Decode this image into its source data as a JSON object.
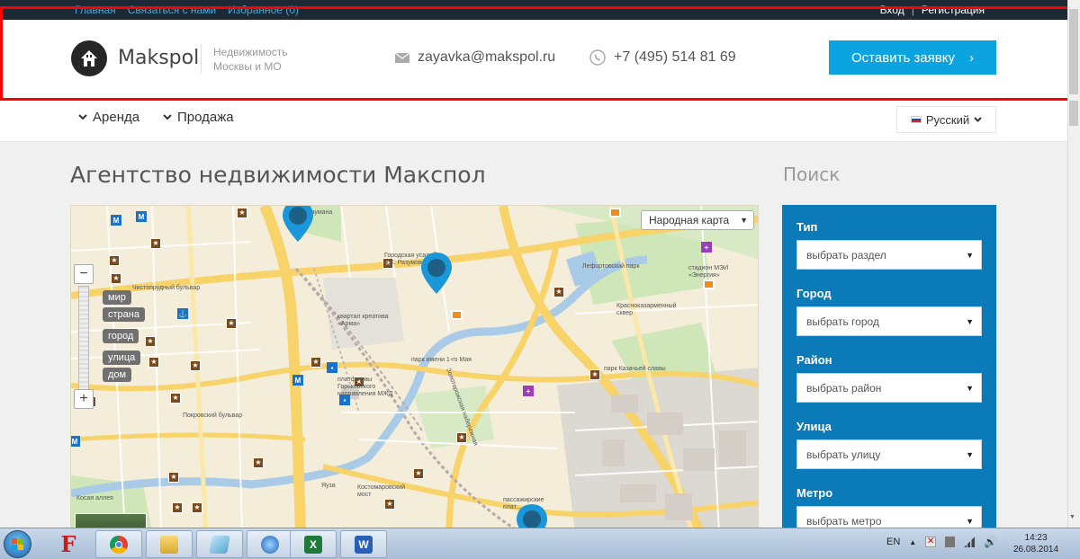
{
  "topbar": {
    "links_left": [
      "Главная",
      "Связаться с нами",
      "Избранное (0)"
    ],
    "login": "Вход",
    "separator": "|",
    "register": "Регистрация"
  },
  "header": {
    "logo_text": "Makspol",
    "tagline_line1": "Недвижимость",
    "tagline_line2": "Москвы и МО",
    "email": "zayavka@makspol.ru",
    "phone": "+7 (495) 514 81 69",
    "cta_label": "Оставить заявку",
    "cta_arrow": "›"
  },
  "nav": {
    "items": [
      "Аренда",
      "Продажа"
    ],
    "language": "Русский"
  },
  "main": {
    "title": "Агентство недвижимости Макспол",
    "search_title": "Поиск"
  },
  "map": {
    "type_selector": "Народная карта",
    "zoom_levels": [
      "мир",
      "страна",
      "город",
      "улица",
      "дом"
    ],
    "zoom_in": "+",
    "zoom_out": "−",
    "labels": [
      "Чистопрудный бульвар",
      "Городская усадьба А.К. Разумовского",
      "квартал креатива «Арма»",
      "парк имени 1-го Мая",
      "платформы Горьковского направления МЖД",
      "Покровский бульвар",
      "Лефортовский парк",
      "стадион МЭИ «Энергия»",
      "Красноказарменный сквер",
      "парк Казачьей славы",
      "Золоторожская набережная",
      "Яуза",
      "Костомаровский мост",
      "Косая аллея",
      "пассажирские плат...",
      "Баумана"
    ]
  },
  "search": {
    "fields": [
      {
        "label": "Тип",
        "value": "выбрать раздел"
      },
      {
        "label": "Город",
        "value": "выбрать город"
      },
      {
        "label": "Район",
        "value": "выбрать район"
      },
      {
        "label": "Улица",
        "value": "выбрать улицу"
      },
      {
        "label": "Метро",
        "value": "выбрать метро"
      }
    ]
  },
  "taskbar": {
    "lang": "EN",
    "time": "14:23",
    "date": "26.08.2014"
  },
  "colors": {
    "accent": "#0ca4e0",
    "panel": "#0a7ab8",
    "topbar": "#1d2a35",
    "frame": "#ff0000"
  }
}
